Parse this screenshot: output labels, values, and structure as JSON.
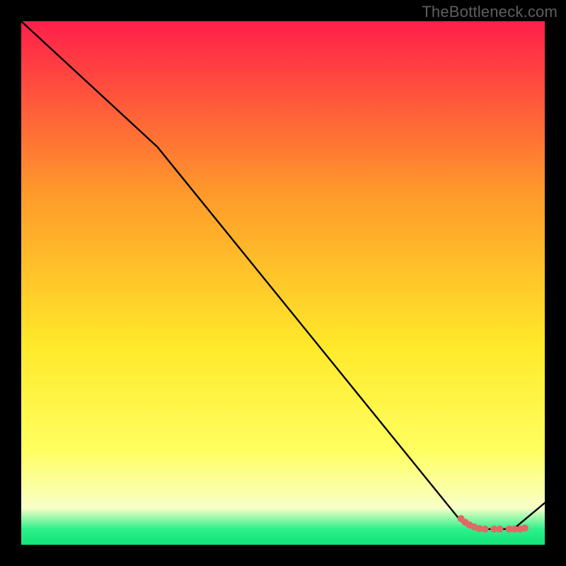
{
  "watermark": "TheBottleneck.com",
  "colors": {
    "frame": "#000000",
    "line": "#000000",
    "marker_fill": "#df6a64",
    "marker_stroke": "#000000",
    "grad_top": "#ff1f4a",
    "grad_mid_upper": "#ff9a2a",
    "grad_mid": "#ffe92a",
    "grad_lower_yellow": "#ffff60",
    "grad_pale": "#f8ffc8",
    "grad_green": "#2ef08a",
    "grad_bottom": "#12e27a"
  },
  "chart_data": {
    "type": "line",
    "title": "",
    "xlabel": "",
    "ylabel": "",
    "xlim": [
      0,
      100
    ],
    "ylim": [
      0,
      100
    ],
    "series": [
      {
        "name": "curve",
        "x": [
          0,
          26,
          84,
          88,
          94,
          100
        ],
        "y": [
          100,
          76,
          4.5,
          3,
          3,
          8
        ]
      }
    ],
    "markers": {
      "name": "bottom-cluster",
      "points": [
        {
          "x": 84.0,
          "y": 5.0
        },
        {
          "x": 84.8,
          "y": 4.3
        },
        {
          "x": 85.6,
          "y": 3.8
        },
        {
          "x": 86.5,
          "y": 3.4
        },
        {
          "x": 87.5,
          "y": 3.1
        },
        {
          "x": 88.6,
          "y": 3.0
        },
        {
          "x": 90.3,
          "y": 3.0
        },
        {
          "x": 91.4,
          "y": 3.0
        },
        {
          "x": 93.2,
          "y": 3.0
        },
        {
          "x": 94.2,
          "y": 3.0
        },
        {
          "x": 95.3,
          "y": 3.0
        },
        {
          "x": 96.2,
          "y": 3.2
        }
      ]
    }
  }
}
